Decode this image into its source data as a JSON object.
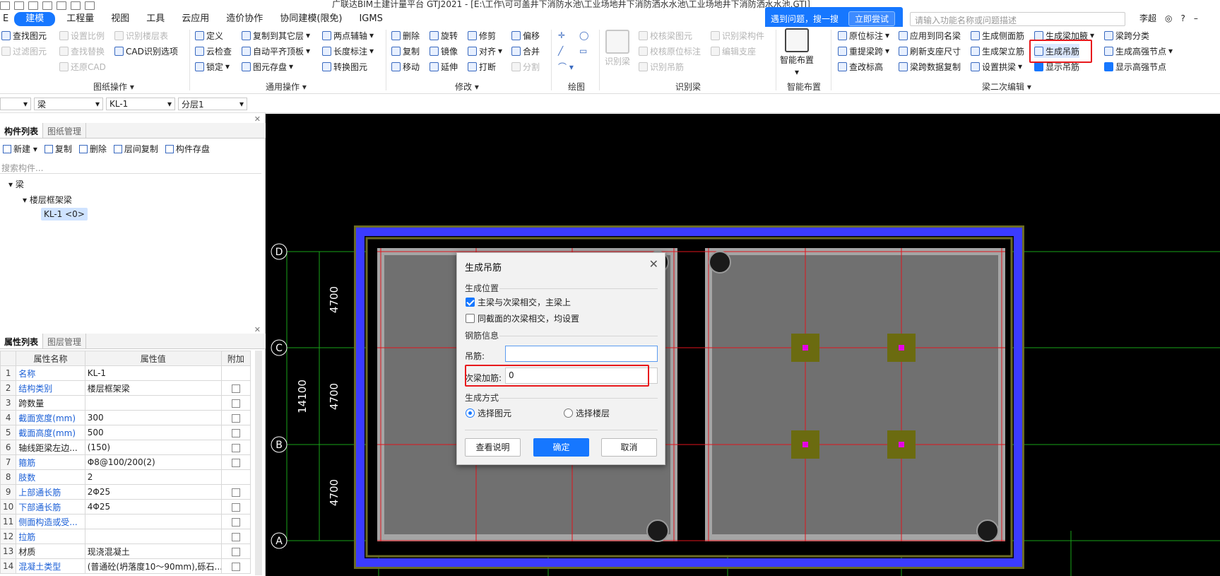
{
  "titlebar": {
    "title": "广联达BIM土建计量平台 GTJ2021 - [E:\\工作\\可可盖井下消防水池\\工业场地井下消防洒水水池\\工业场地井下消防洒水水池.GTJ]"
  },
  "menu": {
    "items": [
      "建模",
      "工程量",
      "视图",
      "工具",
      "云应用",
      "造价协作",
      "协同建模(限免)",
      "IGMS"
    ],
    "active": "建模"
  },
  "help": {
    "prompt": "遇到问题，搜一搜",
    "try_label": "立即尝试",
    "search_placeholder": "请输入功能名称或问题描述",
    "user": "李超"
  },
  "ribbon": {
    "drawing_ops": {
      "items": [
        "查找图元",
        "过滤图元",
        "设置比例",
        "查找替换",
        "还原CAD",
        "识别楼层表",
        "CAD识别选项"
      ],
      "group_label": "图纸操作"
    },
    "common_ops": {
      "items": [
        "定义",
        "云检查",
        "锁定",
        "复制到其它层",
        "自动平齐顶板",
        "图元存盘",
        "两点辅轴",
        "长度标注",
        "转换图元"
      ],
      "group_label": "通用操作"
    },
    "modify": {
      "items": [
        "删除",
        "复制",
        "移动",
        "旋转",
        "镜像",
        "延伸",
        "修剪",
        "对齐",
        "打断",
        "偏移",
        "合并",
        "分割"
      ],
      "group_label": "修改"
    },
    "draw": {
      "group_label": "绘图"
    },
    "identify_beam": {
      "items": [
        "识别梁",
        "校核梁图元",
        "校核原位标注",
        "识别吊筋",
        "识别梁构件",
        "编辑支座"
      ],
      "group_label": "识别梁"
    },
    "smart_layout": {
      "label": "智能布置",
      "group_label": "智能布置"
    },
    "beam_edit": {
      "items": [
        "原位标注",
        "重提梁跨",
        "查改标高",
        "应用到同名梁",
        "刷新支座尺寸",
        "梁跨数据复制",
        "生成侧面筋",
        "生成架立筋",
        "设置拱梁",
        "生成梁加腋",
        "生成吊筋",
        "显示吊筋",
        "梁跨分类",
        "生成高强节点",
        "显示高强节点"
      ],
      "group_label": "梁二次编辑"
    }
  },
  "context": {
    "dd1": "",
    "dd2": "梁",
    "dd3": "KL-1",
    "dd4": "分层1"
  },
  "component_panel": {
    "tabs": [
      "构件列表",
      "图纸管理"
    ],
    "toolbar": [
      "新建",
      "复制",
      "删除",
      "层间复制",
      "构件存盘"
    ],
    "search_placeholder": "搜索构件...",
    "tree": {
      "root": "梁",
      "child": "楼层框架梁",
      "leaf": "KL-1 <0>"
    }
  },
  "property_panel": {
    "tabs": [
      "属性列表",
      "图层管理"
    ],
    "headers": [
      "属性名称",
      "属性值",
      "附加"
    ],
    "rows": [
      {
        "n": "1",
        "name": "名称",
        "value": "KL-1",
        "blue": true,
        "cb": false
      },
      {
        "n": "2",
        "name": "结构类别",
        "value": "楼层框架梁",
        "blue": true,
        "cb": true
      },
      {
        "n": "3",
        "name": "跨数量",
        "value": "",
        "blue": false,
        "cb": true
      },
      {
        "n": "4",
        "name": "截面宽度(mm)",
        "value": "300",
        "blue": true,
        "cb": true
      },
      {
        "n": "5",
        "name": "截面高度(mm)",
        "value": "500",
        "blue": true,
        "cb": true
      },
      {
        "n": "6",
        "name": "轴线距梁左边...",
        "value": "(150)",
        "blue": false,
        "cb": true
      },
      {
        "n": "7",
        "name": "箍筋",
        "value": "Φ8@100/200(2)",
        "blue": true,
        "cb": true
      },
      {
        "n": "8",
        "name": "肢数",
        "value": "2",
        "blue": true,
        "cb": false
      },
      {
        "n": "9",
        "name": "上部通长筋",
        "value": "2Φ25",
        "blue": true,
        "cb": true
      },
      {
        "n": "10",
        "name": "下部通长筋",
        "value": "4Φ25",
        "blue": true,
        "cb": true
      },
      {
        "n": "11",
        "name": "侧面构造或受...",
        "value": "",
        "blue": true,
        "cb": true
      },
      {
        "n": "12",
        "name": "拉筋",
        "value": "",
        "blue": true,
        "cb": true
      },
      {
        "n": "13",
        "name": "材质",
        "value": "现浇混凝土",
        "blue": false,
        "cb": true
      },
      {
        "n": "14",
        "name": "混凝土类型",
        "value": "(普通砼(坍落度10～90mm),砾石...",
        "blue": true,
        "cb": true
      }
    ]
  },
  "canvas": {
    "axes": [
      "D",
      "C",
      "B",
      "A"
    ],
    "dims": [
      "4700",
      "4700",
      "4700"
    ],
    "total": "14100"
  },
  "dialog": {
    "title": "生成吊筋",
    "section_position": "生成位置",
    "opt_main_secondary": "主梁与次梁相交，主梁上",
    "opt_same_section": "同截面的次梁相交，均设置",
    "section_rebar": "钢筋信息",
    "hanger_label": "吊筋:",
    "hanger_value": "",
    "secondary_label": "次梁加筋:",
    "secondary_value": "0",
    "section_method": "生成方式",
    "radio_elements": "选择图元",
    "radio_floors": "选择楼层",
    "btn_help": "查看说明",
    "btn_ok": "确定",
    "btn_cancel": "取消"
  },
  "colors": {
    "accent": "#1677ff",
    "highlight": "#e8191c",
    "slab_border": "#3b3bff"
  }
}
